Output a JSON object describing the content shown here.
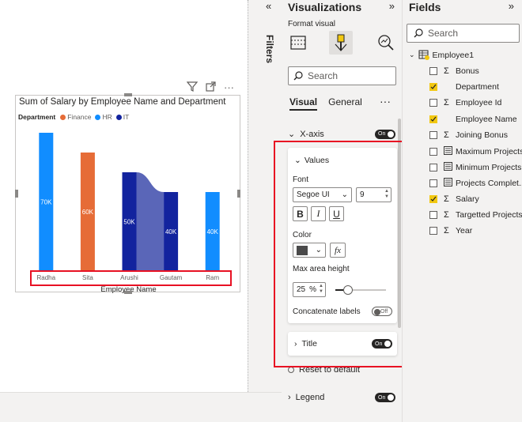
{
  "chart_data": {
    "type": "bar",
    "title": "Sum of Salary by Employee Name and Department",
    "legend_title": "Department",
    "legend": [
      {
        "name": "Finance",
        "color": "#e66c37"
      },
      {
        "name": "HR",
        "color": "#118dff"
      },
      {
        "name": "IT",
        "color": "#12239e"
      }
    ],
    "xlabel": "Employee Name",
    "categories": [
      "Radha",
      "Sita",
      "Arushi",
      "Gautam",
      "Ram"
    ],
    "values": [
      70000,
      60000,
      50000,
      40000,
      40000
    ],
    "data_labels": [
      "70K",
      "60K",
      "50K",
      "40K",
      "40K"
    ],
    "departments": [
      "HR",
      "Finance",
      "IT",
      "IT",
      "HR"
    ],
    "ylim": [
      0,
      72000
    ]
  },
  "filters": {
    "label": "Filters",
    "collapse_icon": "double-chevron-left-icon"
  },
  "visualizations": {
    "title": "Visualizations",
    "format_visual": "Format visual",
    "search_placeholder": "Search",
    "tabs": {
      "visual": "Visual",
      "general": "General",
      "more": "···"
    },
    "x_axis": {
      "label": "X-axis",
      "toggle": "On"
    },
    "values": {
      "label": "Values",
      "font_label": "Font",
      "font_family": "Segoe UI",
      "font_size": "9",
      "bold": "B",
      "italic": "I",
      "underline": "U",
      "color_label": "Color",
      "color_value": "#4a4a4a",
      "fx": "fx",
      "max_area_label": "Max area height",
      "max_area_value": "25",
      "max_area_unit": "%",
      "max_area_fraction": 0.25,
      "concat_label": "Concatenate labels",
      "concat_toggle": "Off"
    },
    "title_section": {
      "label": "Title",
      "toggle": "On"
    },
    "reset": "Reset to default",
    "legend_section": {
      "label": "Legend",
      "toggle": "On"
    }
  },
  "fields": {
    "title": "Fields",
    "search_placeholder": "Search",
    "table": "Employee1",
    "items": [
      {
        "label": "Bonus",
        "checked": false,
        "sigma": true
      },
      {
        "label": "Department",
        "checked": true,
        "sigma": false
      },
      {
        "label": "Employee Id",
        "checked": false,
        "sigma": true
      },
      {
        "label": "Employee Name",
        "checked": true,
        "sigma": false
      },
      {
        "label": "Joining Bonus",
        "checked": false,
        "sigma": true
      },
      {
        "label": "Maximum Projects",
        "checked": false,
        "sigma": false
      },
      {
        "label": "Minimum Projects",
        "checked": false,
        "sigma": false
      },
      {
        "label": "Projects Complet...",
        "checked": false,
        "sigma": false
      },
      {
        "label": "Salary",
        "checked": true,
        "sigma": true
      },
      {
        "label": "Targetted Projects",
        "checked": false,
        "sigma": true
      },
      {
        "label": "Year",
        "checked": false,
        "sigma": true
      }
    ]
  }
}
